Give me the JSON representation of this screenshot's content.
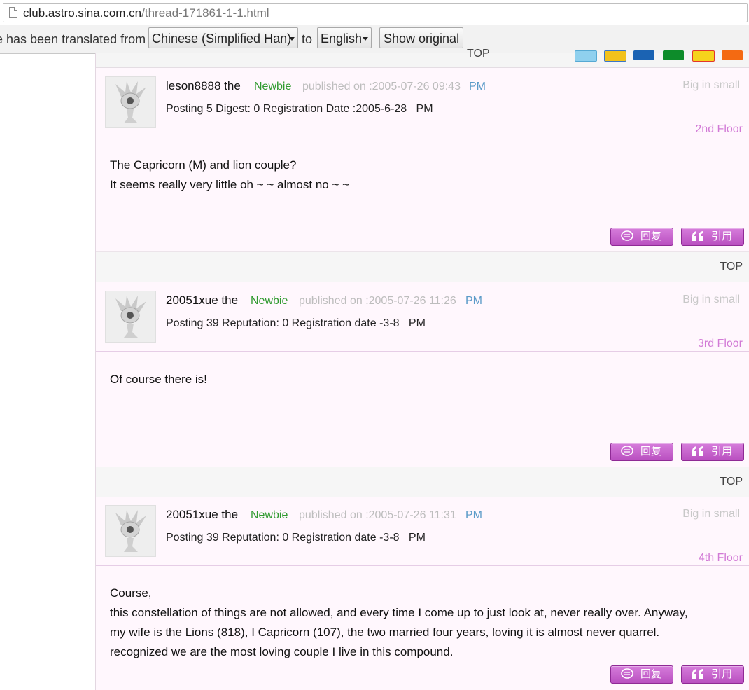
{
  "address_bar": {
    "url_host": "club.astro.sina.com.cn",
    "url_path": "/thread-171861-1-1.html"
  },
  "translate_bar": {
    "message": "e has been translated from",
    "source_language": "Chinese (Simplified Han)",
    "to_label": "to",
    "target_language": "English",
    "show_original_label": "Show original"
  },
  "share_strip": {
    "top_label": "TOP",
    "icons": [
      "weibo-icon",
      "qzone-icon",
      "renren-icon",
      "kaixin-icon",
      "bookmark-icon",
      "share-icon"
    ]
  },
  "posts": [
    {
      "username": "leson8888 the",
      "rank": "Newbie",
      "published": "published on :2005-07-26 09:43",
      "pm": "PM",
      "big_small": "Big in small",
      "stats": "Posting 5 Digest: 0 Registration Date :2005-6-28",
      "stats_pm": "PM",
      "floor": "2nd Floor",
      "body": [
        "The Capricorn (M) and lion couple?",
        "It seems really very little oh ~ ~ almost no ~ ~"
      ],
      "reply_label": "回复",
      "quote_label": "引用"
    },
    {
      "username": "20051xue the",
      "rank": "Newbie",
      "published": "published on :2005-07-26 11:26",
      "pm": "PM",
      "big_small": "Big in small",
      "stats": "Posting 39 Reputation: 0 Registration date -3-8",
      "stats_pm": "PM",
      "floor": "3rd Floor",
      "body": [
        "Of course there is!"
      ],
      "reply_label": "回复",
      "quote_label": "引用"
    },
    {
      "username": "20051xue the",
      "rank": "Newbie",
      "published": "published on :2005-07-26 11:31",
      "pm": "PM",
      "big_small": "Big in small",
      "stats": "Posting 39 Reputation: 0 Registration date -3-8",
      "stats_pm": "PM",
      "floor": "4th Floor",
      "body": [
        "Course,",
        "this constellation of things are not allowed, and every time I come up to just look at, never really over. Anyway,",
        "my wife is the Lions (818), I Capricorn (107), the two married four years, loving it is almost never quarrel.",
        "recognized we are the most loving couple I live in this compound."
      ],
      "reply_label": "回复",
      "quote_label": "引用"
    }
  ],
  "top_strips": [
    {
      "label": "TOP"
    },
    {
      "label": "TOP"
    }
  ],
  "colors": {
    "accent": "#c562cb",
    "rank": "#2f9a2f",
    "floor": "#d27ad6",
    "pm": "#5b9bc8",
    "content_bg": "#fff7fd"
  }
}
